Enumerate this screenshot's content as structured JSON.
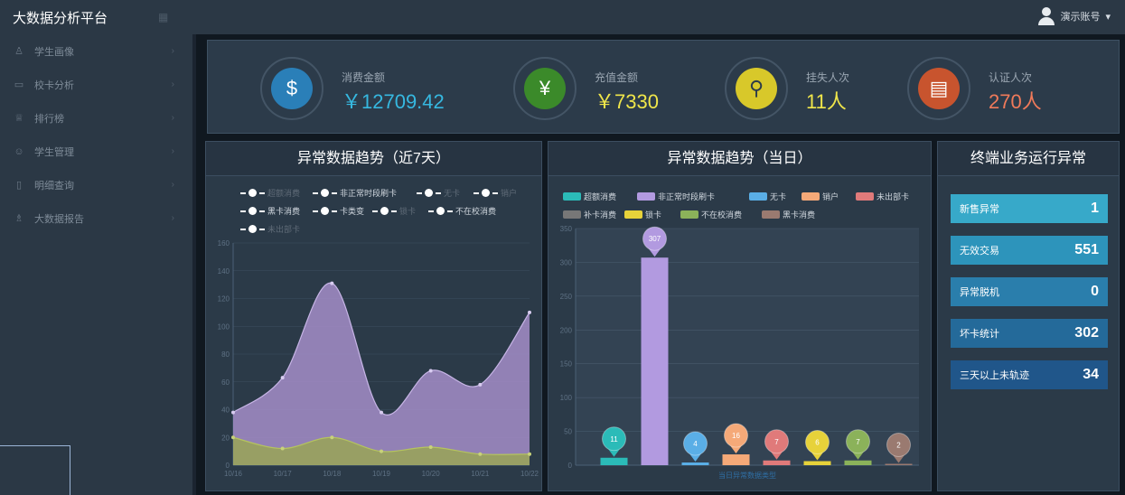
{
  "app": {
    "title": "大数据分析平台",
    "collapse_icon": "grid-icon"
  },
  "user": {
    "name": "演示账号",
    "caret": "▾"
  },
  "sidebar": {
    "items": [
      {
        "label": "学生画像",
        "icon": "user-icon"
      },
      {
        "label": "校卡分析",
        "icon": "card-icon"
      },
      {
        "label": "排行榜",
        "icon": "trophy-icon"
      },
      {
        "label": "学生管理",
        "icon": "people-icon"
      },
      {
        "label": "明细查询",
        "icon": "doc-icon"
      },
      {
        "label": "大数据报告",
        "icon": "report-icon"
      }
    ]
  },
  "stats": [
    {
      "label": "消费金额",
      "value": "￥12709.42",
      "color": "#36b8e0",
      "icon": "coins-icon"
    },
    {
      "label": "充值金额",
      "value": "￥7330",
      "color": "#f0e64a",
      "icon": "money-bag-icon"
    },
    {
      "label": "挂失人次",
      "value": "11人",
      "color": "#f0e64a",
      "icon": "search-hand-icon"
    },
    {
      "label": "认证人次",
      "value": "270人",
      "color": "#f07a5a",
      "icon": "id-card-icon"
    }
  ],
  "panels": {
    "trend7": {
      "title": "异常数据趋势（近7天）"
    },
    "today": {
      "title": "异常数据趋势（当日）"
    },
    "terminal": {
      "title": "终端业务运行异常"
    }
  },
  "chart_data": [
    {
      "type": "area",
      "title": "异常数据趋势（近7天）",
      "legend": [
        {
          "name": "超额消费",
          "active": false
        },
        {
          "name": "非正常时段刷卡",
          "active": true
        },
        {
          "name": "无卡",
          "active": false
        },
        {
          "name": "销户",
          "active": false
        },
        {
          "name": "黑卡消费",
          "active": true
        },
        {
          "name": "卡类变",
          "active": true
        },
        {
          "name": "锁卡",
          "active": false
        },
        {
          "name": "不在校消费",
          "active": true
        },
        {
          "name": "未出部卡",
          "active": false
        }
      ],
      "x": [
        "10/16",
        "10/17",
        "10/18",
        "10/19",
        "10/20",
        "10/21",
        "10/22"
      ],
      "yticks": [
        0,
        20,
        40,
        60,
        80,
        100,
        120,
        140,
        160
      ],
      "ylim": [
        0,
        160
      ],
      "series": [
        {
          "name": "非正常时段刷卡",
          "values": [
            38,
            63,
            131,
            38,
            68,
            58,
            110
          ],
          "color": "#a48ec9"
        },
        {
          "name": "不在校消费",
          "values": [
            20,
            12,
            20,
            10,
            13,
            8,
            8
          ],
          "color": "#9aa94a"
        }
      ]
    },
    {
      "type": "bar",
      "title": "异常数据趋势（当日）",
      "legend": [
        {
          "name": "超额消费",
          "color": "#2bbbb8"
        },
        {
          "name": "非正常时段刷卡",
          "color": "#b29ae0"
        },
        {
          "name": "无卡",
          "color": "#5aaee6"
        },
        {
          "name": "销户",
          "color": "#f5a978"
        },
        {
          "name": "未出部卡",
          "color": "#e07a7a"
        },
        {
          "name": "补卡消费",
          "color": "#777777"
        },
        {
          "name": "锁卡",
          "color": "#e7d23a"
        },
        {
          "name": "不在校消费",
          "color": "#8bb25a"
        },
        {
          "name": "黑卡消费",
          "color": "#9a7a70"
        }
      ],
      "categories": [
        "超额消费",
        "非正常时段刷卡",
        "无卡",
        "销户",
        "未出部卡",
        "锁卡",
        "不在校消费",
        "黑卡消费"
      ],
      "values": [
        11,
        307,
        4,
        16,
        7,
        6,
        7,
        2
      ],
      "yticks": [
        0,
        50,
        100,
        150,
        200,
        250,
        300,
        350
      ],
      "ylim": [
        0,
        350
      ],
      "xlabel": "当日异常数据类型"
    }
  ],
  "terminal": {
    "tiles": [
      {
        "label": "新售异常",
        "value": "1",
        "color": "#37a9c9"
      },
      {
        "label": "无效交易",
        "value": "551",
        "color": "#2d94bb"
      },
      {
        "label": "异常脱机",
        "value": "0",
        "color": "#2a7eac"
      },
      {
        "label": "坏卡统计",
        "value": "302",
        "color": "#246a9a"
      },
      {
        "label": "三天以上未轨迹",
        "value": "34",
        "color": "#20568a"
      }
    ]
  }
}
